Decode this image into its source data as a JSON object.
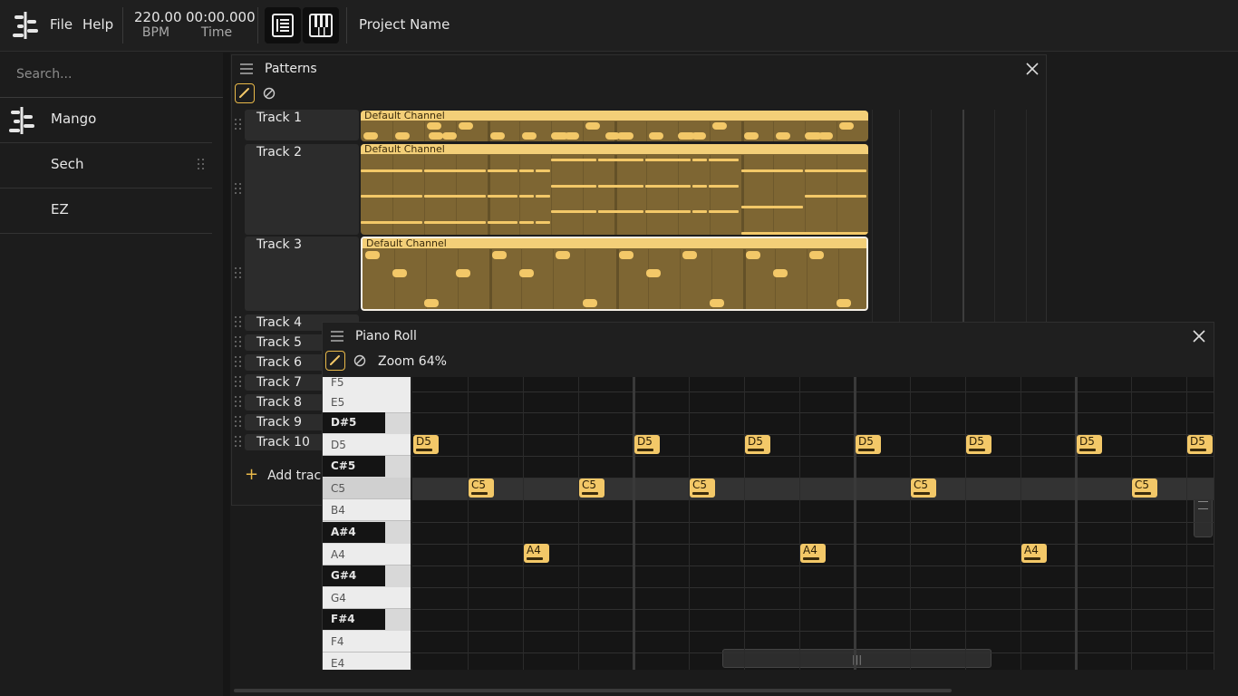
{
  "topbar": {
    "menu": [
      "File",
      "Help"
    ],
    "bpm_value": "220.00",
    "bpm_label": "BPM",
    "time_value": "00:00.000",
    "time_label": "Time",
    "project_name": "Project Name"
  },
  "sidebar": {
    "search_placeholder": "Search...",
    "items": [
      {
        "label": "Mango",
        "icon": "logo-icon"
      },
      {
        "label": "Sech"
      },
      {
        "label": "EZ"
      }
    ]
  },
  "patterns": {
    "title": "Patterns",
    "tracks": [
      "Track 1",
      "Track 2",
      "Track 3",
      "Track 4",
      "Track 5",
      "Track 6",
      "Track 7",
      "Track 8",
      "Track 9",
      "Track 10"
    ],
    "clip_label": "Default Channel",
    "add_track": "Add track"
  },
  "piano_roll": {
    "title": "Piano Roll",
    "zoom": "Zoom 64%",
    "keys": [
      "F5",
      "E5",
      "D#5",
      "D5",
      "C#5",
      "C5",
      "B4",
      "A#4",
      "A4",
      "G#4",
      "G4",
      "F#4",
      "F4",
      "E4"
    ],
    "note_labels": {
      "d5": "D5",
      "c5": "C5",
      "a4": "A4"
    }
  },
  "colors": {
    "accent": "#f3c868",
    "clip": "#7e6633",
    "background": "#1b1b1b"
  }
}
